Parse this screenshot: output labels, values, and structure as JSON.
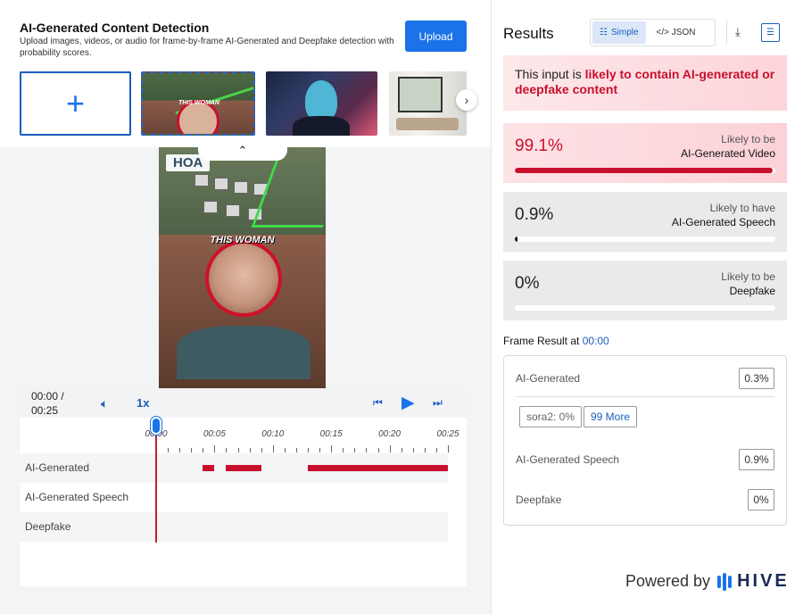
{
  "header": {
    "title": "AI-Generated Content Detection",
    "subtitle": "Upload images, videos, or audio for frame-by-frame AI-Generated and Deepfake detection with probability scores.",
    "upload_label": "Upload"
  },
  "thumbnails": {
    "add_label": "+",
    "video_caption": "THIS WOMAN"
  },
  "video": {
    "overlay_label": "HOA",
    "caption": "THIS WOMAN"
  },
  "player": {
    "time_current": "00:00 /",
    "time_total": "00:25",
    "speed": "1x",
    "ticks": [
      "00:00",
      "00:05",
      "00:10",
      "00:15",
      "00:20",
      "00:25"
    ],
    "duration_s": 25,
    "tracks": [
      {
        "label": "AI-Generated",
        "segments": [
          [
            4.0,
            5.0
          ],
          [
            6.0,
            9.0
          ],
          [
            13.0,
            25.0
          ]
        ]
      },
      {
        "label": "AI-Generated Speech",
        "segments": []
      },
      {
        "label": "Deepfake",
        "segments": []
      }
    ]
  },
  "results": {
    "title": "Results",
    "toggle_simple": "Simple",
    "toggle_json": "</> JSON",
    "verdict_prefix": "This input is ",
    "verdict_highlight": "likely to contain AI-generated or deepfake content",
    "cards": [
      {
        "pct": "99.1%",
        "value": 0.991,
        "line1": "Likely to be",
        "line2": "AI-Generated Video",
        "style": "red"
      },
      {
        "pct": "0.9%",
        "value": 0.009,
        "line1": "Likely to have",
        "line2": "AI-Generated Speech",
        "style": "grey"
      },
      {
        "pct": "0%",
        "value": 0.0,
        "line1": "Likely to be",
        "line2": "Deepfake",
        "style": "grey"
      }
    ]
  },
  "frame": {
    "title": "Frame Result at ",
    "time": "00:00",
    "ai_label": "AI-Generated",
    "ai_value": "0.3%",
    "chip_model": "sora2: 0%",
    "chip_more": "99 More",
    "speech_label": "AI-Generated Speech",
    "speech_value": "0.9%",
    "deepfake_label": "Deepfake",
    "deepfake_value": "0%"
  },
  "footer": {
    "powered_by": "Powered by",
    "brand": "HIVE"
  },
  "colors": {
    "accent": "#1a73e8",
    "danger": "#c8102e"
  }
}
